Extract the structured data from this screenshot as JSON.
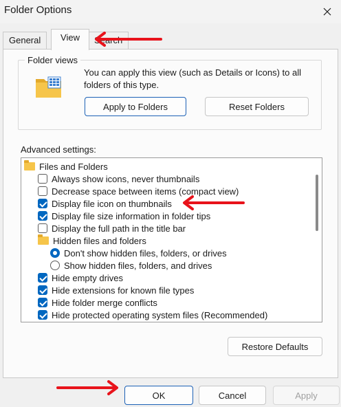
{
  "window": {
    "title": "Folder Options"
  },
  "tabs": [
    {
      "label": "General"
    },
    {
      "label": "View"
    },
    {
      "label": "Search"
    }
  ],
  "folder_views": {
    "label": "Folder views",
    "description": "You can apply this view (such as Details or Icons) to all folders of this type.",
    "apply_button": "Apply to Folders",
    "reset_button": "Reset Folders"
  },
  "advanced": {
    "label": "Advanced settings:",
    "items": [
      {
        "kind": "folder",
        "label": "Files and Folders",
        "checked": null
      },
      {
        "kind": "checkbox",
        "label": "Always show icons, never thumbnails",
        "checked": false
      },
      {
        "kind": "checkbox",
        "label": "Decrease space between items (compact view)",
        "checked": false
      },
      {
        "kind": "checkbox",
        "label": "Display file icon on thumbnails",
        "checked": true
      },
      {
        "kind": "checkbox",
        "label": "Display file size information in folder tips",
        "checked": true
      },
      {
        "kind": "checkbox",
        "label": "Display the full path in the title bar",
        "checked": false
      },
      {
        "kind": "folder",
        "label": "Hidden files and folders",
        "checked": null
      },
      {
        "kind": "radio",
        "label": "Don't show hidden files, folders, or drives",
        "checked": true
      },
      {
        "kind": "radio",
        "label": "Show hidden files, folders, and drives",
        "checked": false
      },
      {
        "kind": "checkbox",
        "label": "Hide empty drives",
        "checked": true
      },
      {
        "kind": "checkbox",
        "label": "Hide extensions for known file types",
        "checked": true
      },
      {
        "kind": "checkbox",
        "label": "Hide folder merge conflicts",
        "checked": true
      },
      {
        "kind": "checkbox",
        "label": "Hide protected operating system files (Recommended)",
        "checked": true
      }
    ],
    "restore_button": "Restore Defaults"
  },
  "footer": {
    "ok": "OK",
    "cancel": "Cancel",
    "apply": "Apply"
  },
  "colors": {
    "accent": "#0067c0",
    "annotation_arrow": "#e8131b"
  }
}
